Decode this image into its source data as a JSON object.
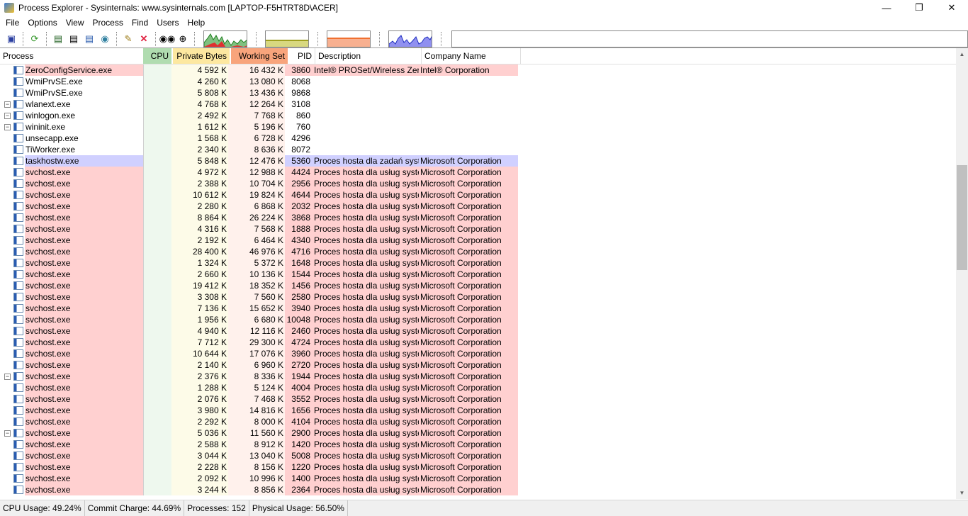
{
  "window": {
    "title": "Process Explorer - Sysinternals: www.sysinternals.com [LAPTOP-F5HTRT8D\\ACER]",
    "minimize": "—",
    "restore": "❐",
    "close": "✕"
  },
  "menu": [
    "File",
    "Options",
    "View",
    "Process",
    "Find",
    "Users",
    "Help"
  ],
  "columns": {
    "process": "Process",
    "cpu": "CPU",
    "private": "Private Bytes",
    "working": "Working Set",
    "pid": "PID",
    "desc": "Description",
    "company": "Company Name"
  },
  "colors": {
    "pink": "#ffd0d0",
    "lavender": "#d0d0ff",
    "cpu_header": "#b0dcb0",
    "private_header": "#fde8a0",
    "working_header": "#f8a47c"
  },
  "rows": [
    {
      "name": "ZeroConfigService.exe",
      "private": "4 592 K",
      "working": "16 432 K",
      "pid": "3860",
      "desc": "Intel® PROSet/Wireless Zer...",
      "company": "Intel® Corporation",
      "hl": "pink",
      "exp": false
    },
    {
      "name": "WmiPrvSE.exe",
      "private": "4 260 K",
      "working": "13 080 K",
      "pid": "8068",
      "desc": "",
      "company": "",
      "hl": "",
      "exp": false
    },
    {
      "name": "WmiPrvSE.exe",
      "private": "5 808 K",
      "working": "13 436 K",
      "pid": "9868",
      "desc": "",
      "company": "",
      "hl": "",
      "exp": false
    },
    {
      "name": "wlanext.exe",
      "private": "4 768 K",
      "working": "12 264 K",
      "pid": "3108",
      "desc": "",
      "company": "",
      "hl": "",
      "exp": true
    },
    {
      "name": "winlogon.exe",
      "private": "2 492 K",
      "working": "7 768 K",
      "pid": "860",
      "desc": "",
      "company": "",
      "hl": "",
      "exp": true
    },
    {
      "name": "wininit.exe",
      "private": "1 612 K",
      "working": "5 196 K",
      "pid": "760",
      "desc": "",
      "company": "",
      "hl": "",
      "exp": true
    },
    {
      "name": "unsecapp.exe",
      "private": "1 568 K",
      "working": "6 728 K",
      "pid": "4296",
      "desc": "",
      "company": "",
      "hl": "",
      "exp": false
    },
    {
      "name": "TiWorker.exe",
      "private": "2 340 K",
      "working": "8 636 K",
      "pid": "8072",
      "desc": "",
      "company": "",
      "hl": "",
      "exp": false
    },
    {
      "name": "taskhostw.exe",
      "private": "5 848 K",
      "working": "12 476 K",
      "pid": "5360",
      "desc": "Proces hosta dla zadań syst...",
      "company": "Microsoft Corporation",
      "hl": "lavender",
      "exp": false
    },
    {
      "name": "svchost.exe",
      "private": "4 972 K",
      "working": "12 988 K",
      "pid": "4424",
      "desc": "Proces hosta dla usług syste...",
      "company": "Microsoft Corporation",
      "hl": "pink",
      "exp": false
    },
    {
      "name": "svchost.exe",
      "private": "2 388 K",
      "working": "10 704 K",
      "pid": "2956",
      "desc": "Proces hosta dla usług syste...",
      "company": "Microsoft Corporation",
      "hl": "pink",
      "exp": false
    },
    {
      "name": "svchost.exe",
      "private": "10 612 K",
      "working": "19 824 K",
      "pid": "4644",
      "desc": "Proces hosta dla usług syste...",
      "company": "Microsoft Corporation",
      "hl": "pink",
      "exp": false
    },
    {
      "name": "svchost.exe",
      "private": "2 280 K",
      "working": "6 868 K",
      "pid": "2032",
      "desc": "Proces hosta dla usług syste...",
      "company": "Microsoft Corporation",
      "hl": "pink",
      "exp": false
    },
    {
      "name": "svchost.exe",
      "private": "8 864 K",
      "working": "26 224 K",
      "pid": "3868",
      "desc": "Proces hosta dla usług syste...",
      "company": "Microsoft Corporation",
      "hl": "pink",
      "exp": false
    },
    {
      "name": "svchost.exe",
      "private": "4 316 K",
      "working": "7 568 K",
      "pid": "1888",
      "desc": "Proces hosta dla usług syste...",
      "company": "Microsoft Corporation",
      "hl": "pink",
      "exp": false
    },
    {
      "name": "svchost.exe",
      "private": "2 192 K",
      "working": "6 464 K",
      "pid": "4340",
      "desc": "Proces hosta dla usług syste...",
      "company": "Microsoft Corporation",
      "hl": "pink",
      "exp": false
    },
    {
      "name": "svchost.exe",
      "private": "28 400 K",
      "working": "46 976 K",
      "pid": "4716",
      "desc": "Proces hosta dla usług syste...",
      "company": "Microsoft Corporation",
      "hl": "pink",
      "exp": false
    },
    {
      "name": "svchost.exe",
      "private": "1 324 K",
      "working": "5 372 K",
      "pid": "1648",
      "desc": "Proces hosta dla usług syste...",
      "company": "Microsoft Corporation",
      "hl": "pink",
      "exp": false
    },
    {
      "name": "svchost.exe",
      "private": "2 660 K",
      "working": "10 136 K",
      "pid": "1544",
      "desc": "Proces hosta dla usług syste...",
      "company": "Microsoft Corporation",
      "hl": "pink",
      "exp": false
    },
    {
      "name": "svchost.exe",
      "private": "19 412 K",
      "working": "18 352 K",
      "pid": "1456",
      "desc": "Proces hosta dla usług syste...",
      "company": "Microsoft Corporation",
      "hl": "pink",
      "exp": false
    },
    {
      "name": "svchost.exe",
      "private": "3 308 K",
      "working": "7 560 K",
      "pid": "2580",
      "desc": "Proces hosta dla usług syste...",
      "company": "Microsoft Corporation",
      "hl": "pink",
      "exp": false
    },
    {
      "name": "svchost.exe",
      "private": "7 136 K",
      "working": "15 652 K",
      "pid": "3940",
      "desc": "Proces hosta dla usług syste...",
      "company": "Microsoft Corporation",
      "hl": "pink",
      "exp": false
    },
    {
      "name": "svchost.exe",
      "private": "1 956 K",
      "working": "6 680 K",
      "pid": "10048",
      "desc": "Proces hosta dla usług syste...",
      "company": "Microsoft Corporation",
      "hl": "pink",
      "exp": false
    },
    {
      "name": "svchost.exe",
      "private": "4 940 K",
      "working": "12 116 K",
      "pid": "2460",
      "desc": "Proces hosta dla usług syste...",
      "company": "Microsoft Corporation",
      "hl": "pink",
      "exp": false
    },
    {
      "name": "svchost.exe",
      "private": "7 712 K",
      "working": "29 300 K",
      "pid": "4724",
      "desc": "Proces hosta dla usług syste...",
      "company": "Microsoft Corporation",
      "hl": "pink",
      "exp": false
    },
    {
      "name": "svchost.exe",
      "private": "10 644 K",
      "working": "17 076 K",
      "pid": "3960",
      "desc": "Proces hosta dla usług syste...",
      "company": "Microsoft Corporation",
      "hl": "pink",
      "exp": false
    },
    {
      "name": "svchost.exe",
      "private": "2 140 K",
      "working": "6 960 K",
      "pid": "2720",
      "desc": "Proces hosta dla usług syste...",
      "company": "Microsoft Corporation",
      "hl": "pink",
      "exp": false
    },
    {
      "name": "svchost.exe",
      "private": "2 376 K",
      "working": "8 336 K",
      "pid": "1944",
      "desc": "Proces hosta dla usług syste...",
      "company": "Microsoft Corporation",
      "hl": "pink",
      "exp": true
    },
    {
      "name": "svchost.exe",
      "private": "1 288 K",
      "working": "5 124 K",
      "pid": "4004",
      "desc": "Proces hosta dla usług syste...",
      "company": "Microsoft Corporation",
      "hl": "pink",
      "exp": false
    },
    {
      "name": "svchost.exe",
      "private": "2 076 K",
      "working": "7 468 K",
      "pid": "3552",
      "desc": "Proces hosta dla usług syste...",
      "company": "Microsoft Corporation",
      "hl": "pink",
      "exp": false
    },
    {
      "name": "svchost.exe",
      "private": "3 980 K",
      "working": "14 816 K",
      "pid": "1656",
      "desc": "Proces hosta dla usług syste...",
      "company": "Microsoft Corporation",
      "hl": "pink",
      "exp": false
    },
    {
      "name": "svchost.exe",
      "private": "2 292 K",
      "working": "8 000 K",
      "pid": "4104",
      "desc": "Proces hosta dla usług syste...",
      "company": "Microsoft Corporation",
      "hl": "pink",
      "exp": false
    },
    {
      "name": "svchost.exe",
      "private": "5 036 K",
      "working": "11 560 K",
      "pid": "2900",
      "desc": "Proces hosta dla usług syste...",
      "company": "Microsoft Corporation",
      "hl": "pink",
      "exp": true
    },
    {
      "name": "svchost.exe",
      "private": "2 588 K",
      "working": "8 912 K",
      "pid": "1420",
      "desc": "Proces hosta dla usług syste...",
      "company": "Microsoft Corporation",
      "hl": "pink",
      "exp": false
    },
    {
      "name": "svchost.exe",
      "private": "3 044 K",
      "working": "13 040 K",
      "pid": "5008",
      "desc": "Proces hosta dla usług syste...",
      "company": "Microsoft Corporation",
      "hl": "pink",
      "exp": false
    },
    {
      "name": "svchost.exe",
      "private": "2 228 K",
      "working": "8 156 K",
      "pid": "1220",
      "desc": "Proces hosta dla usług syste...",
      "company": "Microsoft Corporation",
      "hl": "pink",
      "exp": false
    },
    {
      "name": "svchost.exe",
      "private": "2 092 K",
      "working": "10 996 K",
      "pid": "1400",
      "desc": "Proces hosta dla usług syste...",
      "company": "Microsoft Corporation",
      "hl": "pink",
      "exp": false
    },
    {
      "name": "svchost.exe",
      "private": "3 244 K",
      "working": "8 856 K",
      "pid": "2364",
      "desc": "Proces hosta dla usług syste...",
      "company": "Microsoft Corporation",
      "hl": "pink",
      "exp": false
    }
  ],
  "status": {
    "cpu": "CPU Usage: 49.24%",
    "commit": "Commit Charge: 44.69%",
    "processes": "Processes: 152",
    "physical": "Physical Usage: 56.50%"
  }
}
